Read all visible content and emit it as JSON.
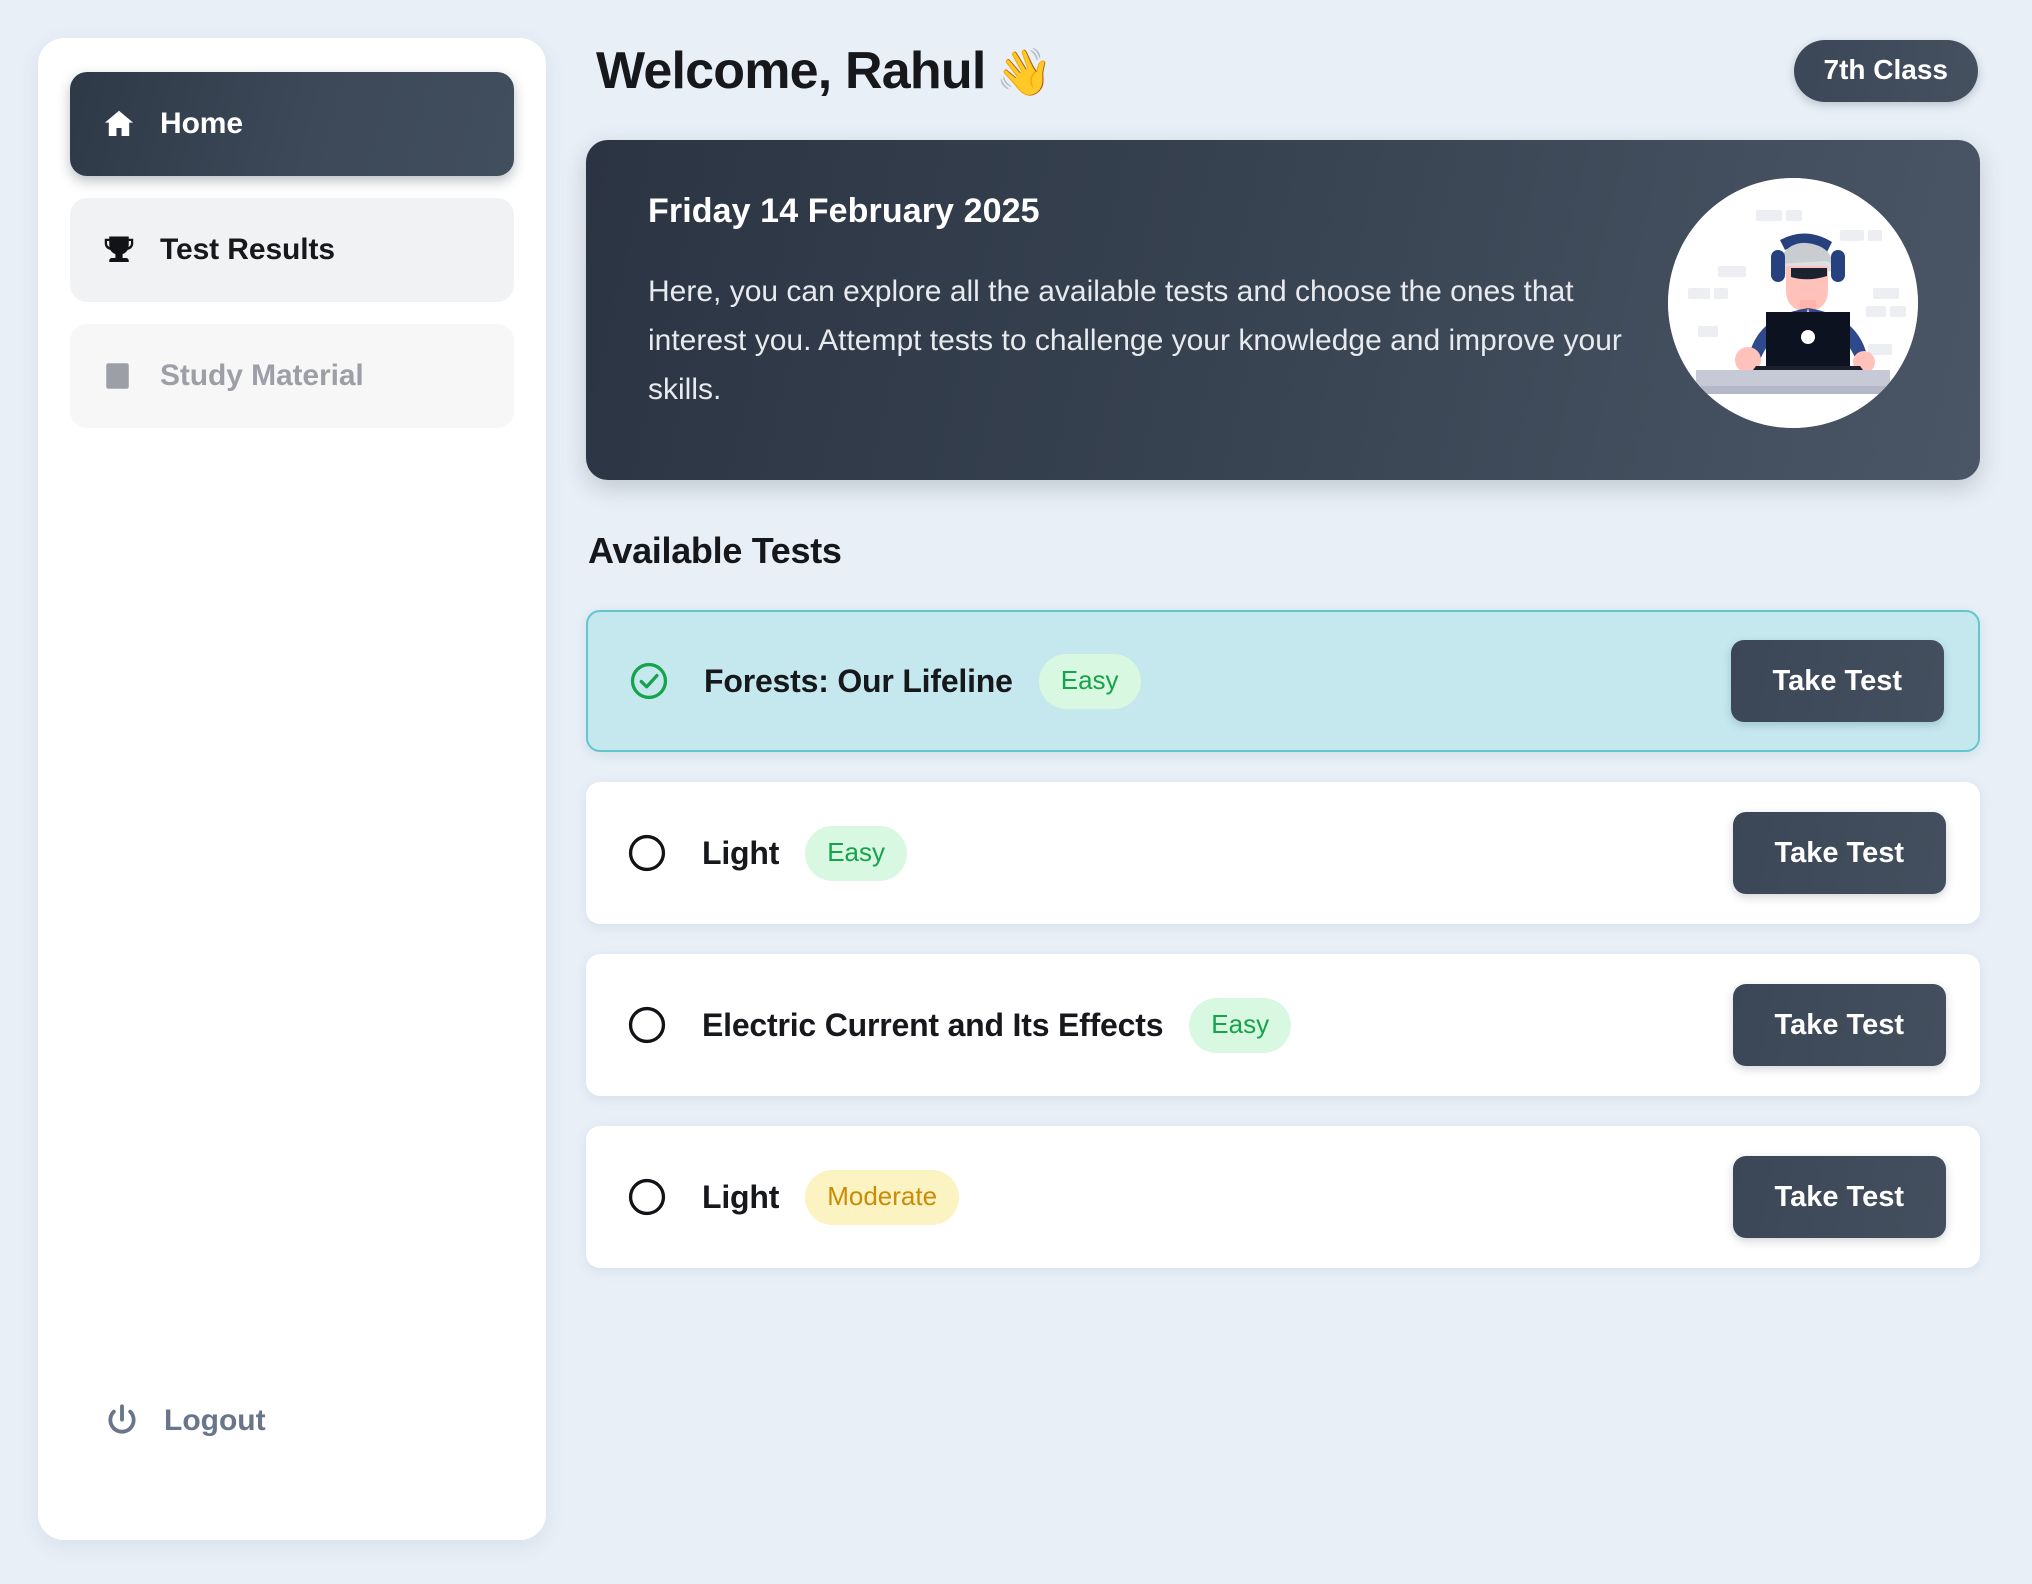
{
  "sidebar": {
    "items": [
      {
        "label": "Home",
        "icon": "home-icon",
        "state": "active"
      },
      {
        "label": "Test Results",
        "icon": "trophy-icon",
        "state": "plain"
      },
      {
        "label": "Study Material",
        "icon": "book-icon",
        "state": "muted"
      }
    ],
    "logout": {
      "label": "Logout",
      "icon": "power-icon"
    }
  },
  "header": {
    "title": "Welcome, Rahul",
    "wave_emoji": "👋",
    "class_badge": "7th Class"
  },
  "banner": {
    "date": "Friday 14 February 2025",
    "description": "Here, you can explore all the available tests and choose the ones that interest you. Attempt tests to challenge your knowledge and improve your skills.",
    "avatar_icon": "student-at-laptop-illustration"
  },
  "main": {
    "section_title": "Available Tests",
    "tests": [
      {
        "name": "Forests: Our Lifeline",
        "difficulty": "Easy",
        "difficulty_level": "easy",
        "selected": true,
        "state_icon": "check-circle-icon",
        "action_label": "Take Test"
      },
      {
        "name": "Light",
        "difficulty": "Easy",
        "difficulty_level": "easy",
        "selected": false,
        "state_icon": "empty-circle-icon",
        "action_label": "Take Test"
      },
      {
        "name": "Electric Current and Its Effects",
        "difficulty": "Easy",
        "difficulty_level": "easy",
        "selected": false,
        "state_icon": "empty-circle-icon",
        "action_label": "Take Test"
      },
      {
        "name": "Light",
        "difficulty": "Moderate",
        "difficulty_level": "moderate",
        "selected": false,
        "state_icon": "empty-circle-icon",
        "action_label": "Take Test"
      }
    ]
  },
  "colors": {
    "page_background": "#e8eff7",
    "card_background": "#ffffff",
    "dark_slate": "#3b4757",
    "selected_card_fill": "#c5e8ef",
    "selected_card_border": "#62c6cf",
    "easy_badge_bg": "#d8f8e1",
    "easy_badge_text": "#17a349",
    "moderate_badge_bg": "#fcf3c2",
    "moderate_badge_text": "#cb8b05",
    "check_green": "#16a34a",
    "logout_gray": "#69758a",
    "muted_text": "#9ca0a6"
  }
}
